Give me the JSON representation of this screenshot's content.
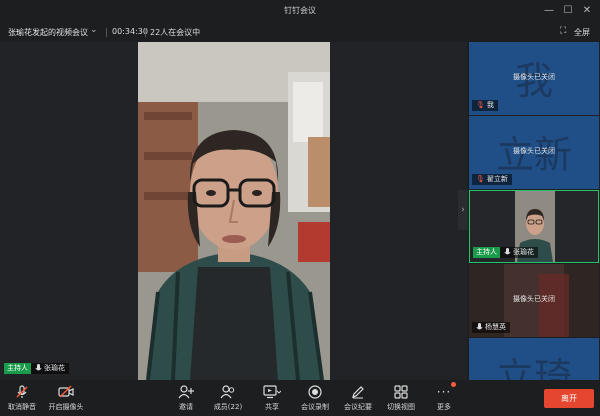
{
  "window": {
    "title": "钉钉会议"
  },
  "meeting": {
    "name": "张瑜花发起的视频会议",
    "timer": "00:34:30",
    "participants_text": "22人在会议中",
    "fullscreen_label": "全屏"
  },
  "stage": {
    "host_tag": "主持人",
    "speaker_name": "张瑜花"
  },
  "tiles": [
    {
      "big_char": "我",
      "status": "摄像头已关闭",
      "name": "我"
    },
    {
      "big_char": "立新",
      "status": "摄像头已关闭",
      "name": "翟立新"
    },
    {
      "host_tag": "主持人",
      "name": "张瑜花"
    },
    {
      "status": "摄像头已关闭",
      "name": "杨慧英"
    },
    {
      "big_char": "立琦"
    }
  ],
  "toolbar": {
    "mute_label": "取消静音",
    "camera_label": "开启摄像头",
    "invite_label": "邀请",
    "members_label": "成员(22)",
    "share_label": "共享",
    "record_label": "会议录制",
    "minutes_label": "会议纪要",
    "layout_label": "切换视图",
    "more_label": "更多",
    "leave_label": "离开"
  },
  "colors": {
    "accent_green": "#1a9b4a",
    "tile_blue": "#1f4f86",
    "leave_red": "#e4462f",
    "active_border": "#24c46b"
  }
}
